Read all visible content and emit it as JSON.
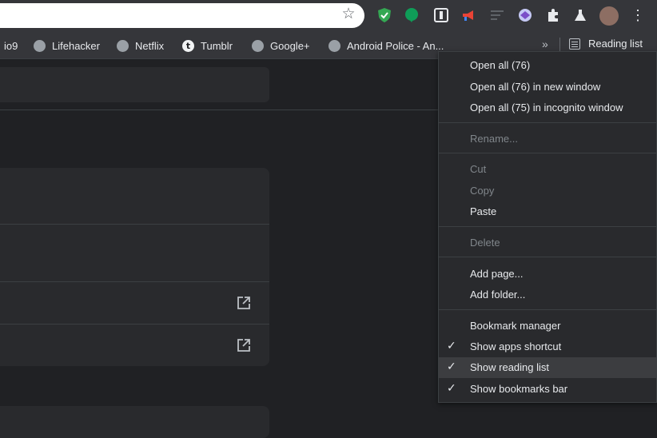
{
  "bookmarks_bar": {
    "items": [
      {
        "label": "io9"
      },
      {
        "label": "Lifehacker"
      },
      {
        "label": "Netflix"
      },
      {
        "label": "Tumblr"
      },
      {
        "label": "Google+"
      },
      {
        "label": "Android Police - An..."
      }
    ],
    "overflow": "»",
    "reading_list": "Reading list"
  },
  "toolbar": {
    "star": "☆",
    "menu": "⋮"
  },
  "context_menu": {
    "groups": [
      [
        "Open all (76)",
        "Open all (76) in new window",
        "Open all (75) in incognito window"
      ],
      [
        "Rename..."
      ],
      [
        "Cut",
        "Copy",
        "Paste"
      ],
      [
        "Delete"
      ],
      [
        "Add page...",
        "Add folder..."
      ],
      [
        "Bookmark manager",
        "Show apps shortcut",
        "Show reading list",
        "Show bookmarks bar"
      ]
    ],
    "checkmark": "✓"
  },
  "colors": {
    "menu_bg": "#292a2d",
    "highlight": "#3c3d40",
    "page_bg": "#202124"
  }
}
